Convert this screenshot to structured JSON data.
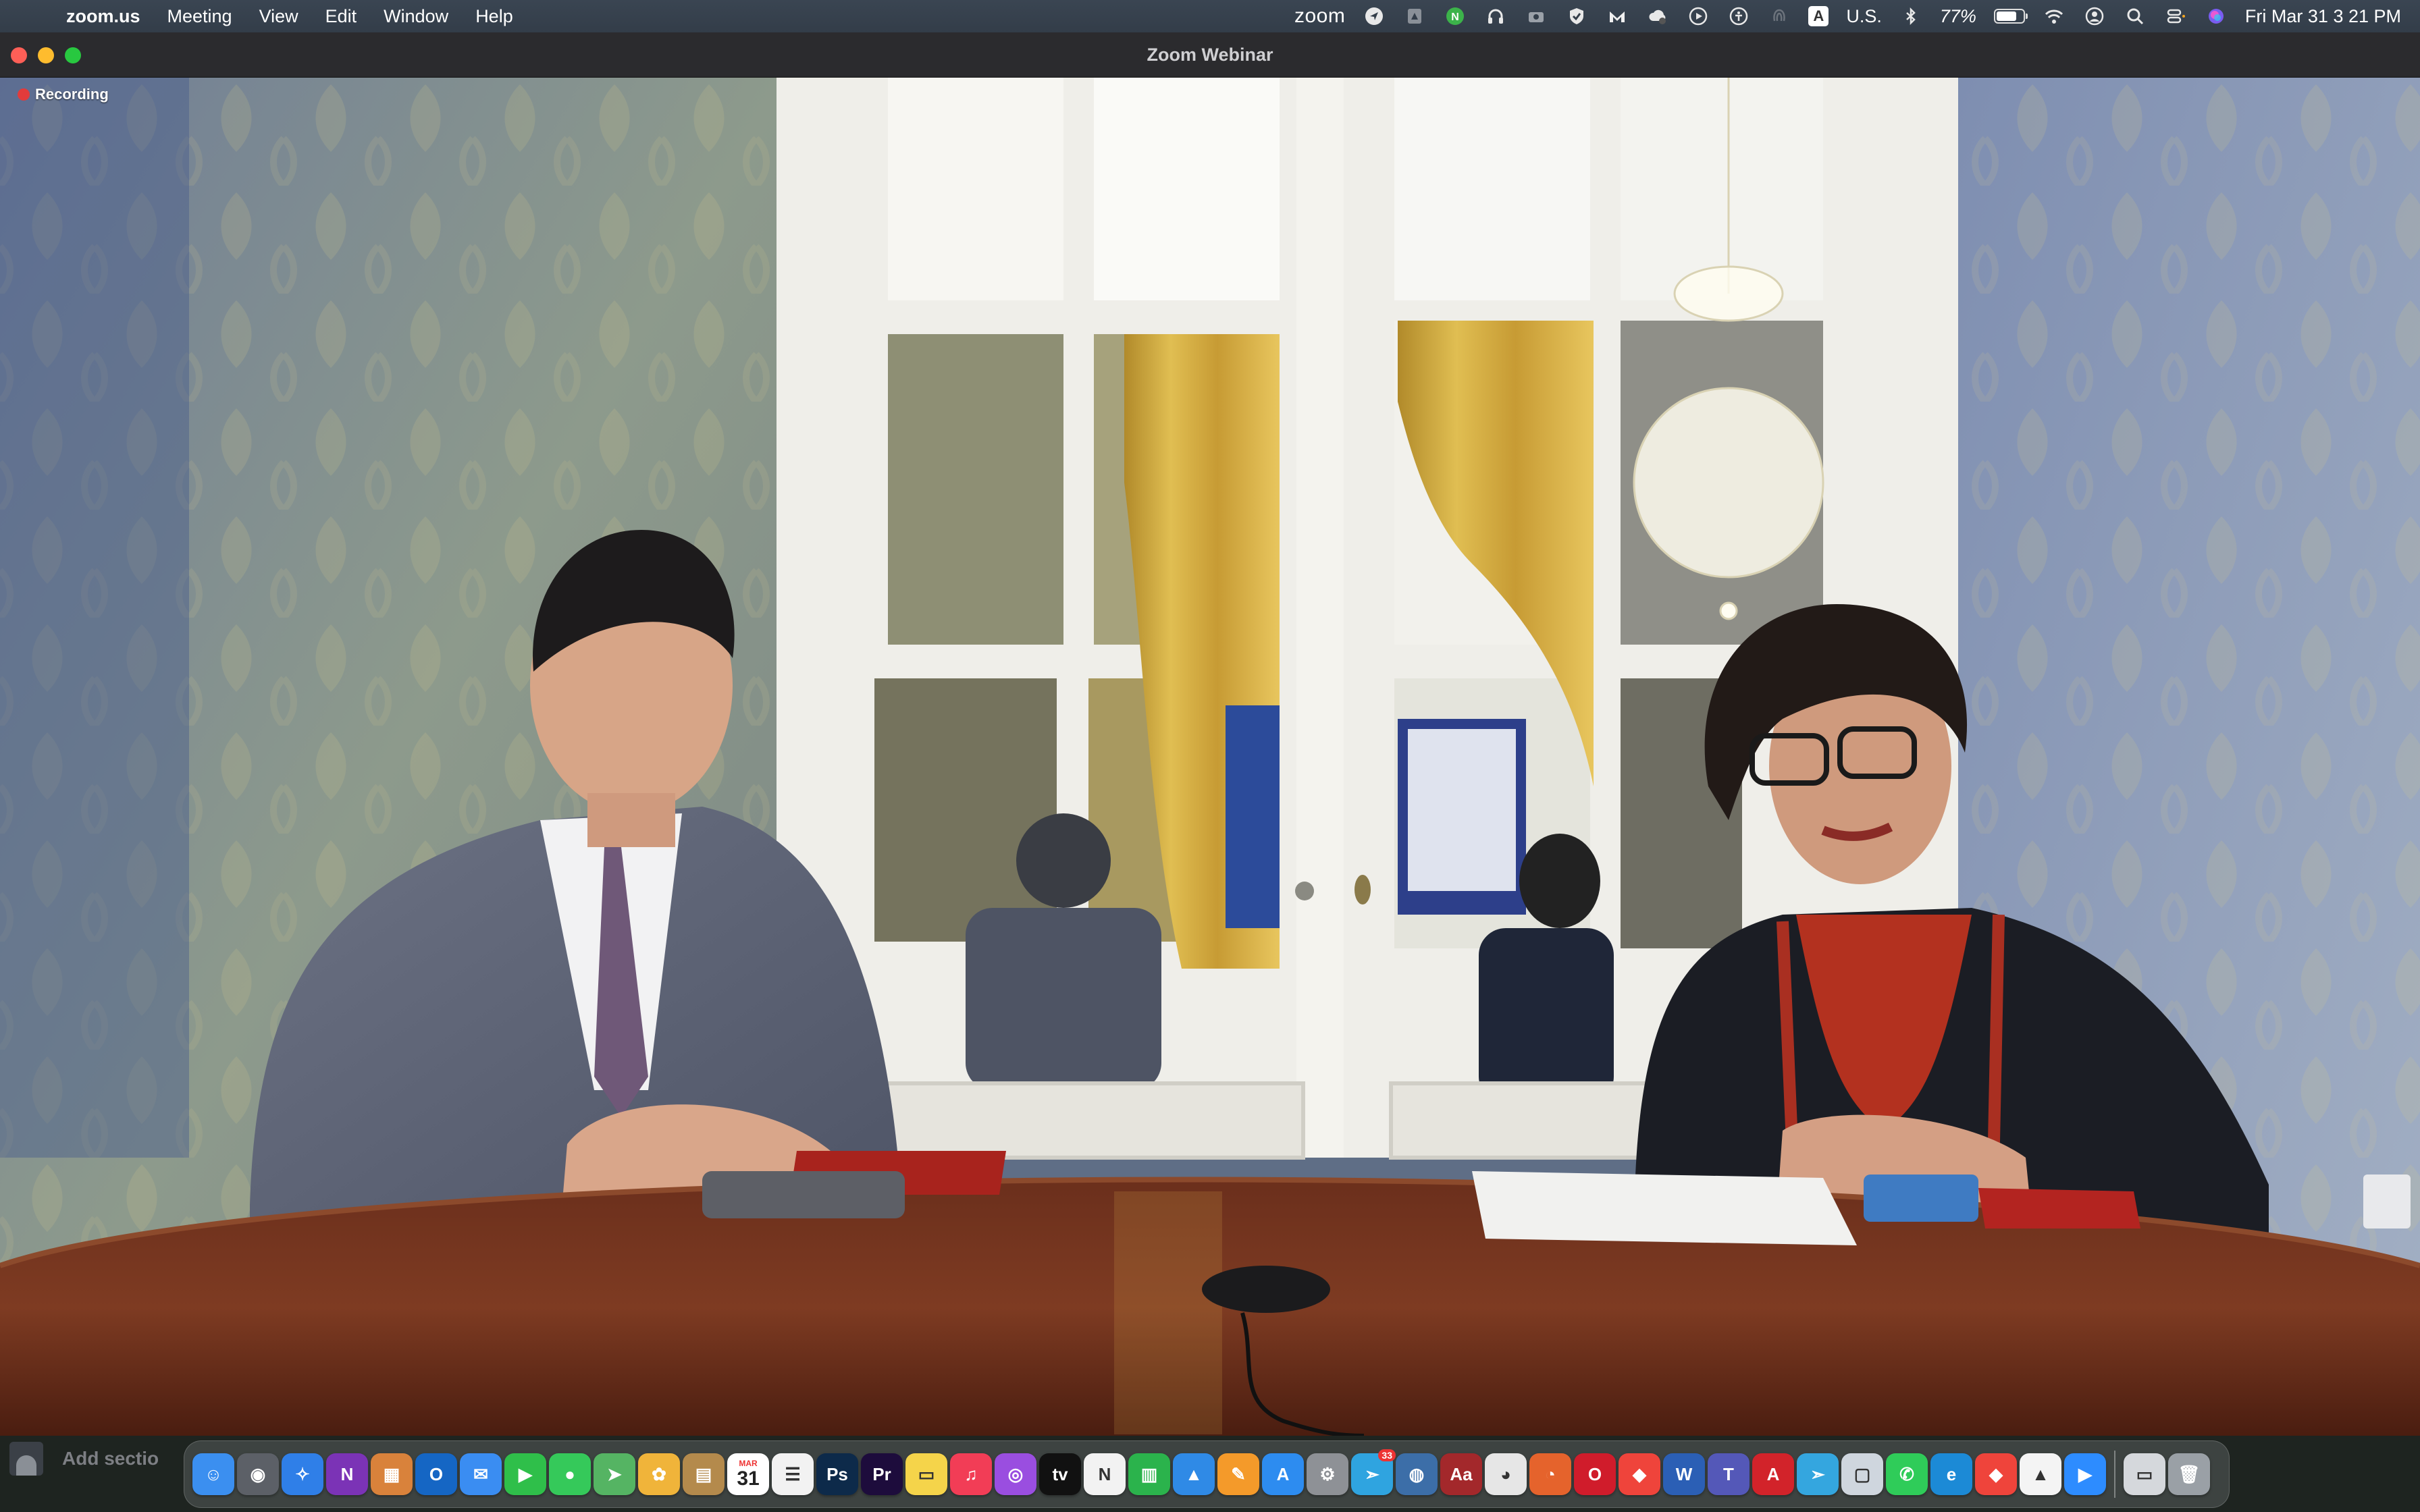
{
  "menubar": {
    "app_name": "zoom.us",
    "menus": [
      "Meeting",
      "View",
      "Edit",
      "Window",
      "Help"
    ],
    "zoom_brand": "zoom",
    "input_source": "U.S.",
    "input_badge": "A",
    "battery_percent": "77%",
    "battery_level": 0.77,
    "datetime": "Fri Mar 31  3 21 PM"
  },
  "window": {
    "title": "Zoom Webinar"
  },
  "video": {
    "recording_label": "Recording"
  },
  "bottom": {
    "add_section_label": "Add sectio"
  },
  "dock": {
    "calendar_month": "MAR",
    "calendar_day": "31",
    "telegram_badge": "33",
    "apps": [
      {
        "name": "finder",
        "color": "#3b8ff0",
        "glyph": "☺"
      },
      {
        "name": "screenshot",
        "color": "#5c6067",
        "glyph": "◉"
      },
      {
        "name": "safari",
        "color": "#2f7fe8",
        "glyph": "✧"
      },
      {
        "name": "onenote",
        "color": "#7b33b6",
        "glyph": "N"
      },
      {
        "name": "launchpad",
        "color": "#d9823b",
        "glyph": "▦"
      },
      {
        "name": "outlook",
        "color": "#1566c4",
        "glyph": "O"
      },
      {
        "name": "mail",
        "color": "#3a8df2",
        "glyph": "✉"
      },
      {
        "name": "facetime",
        "color": "#2fbf4a",
        "glyph": "▶"
      },
      {
        "name": "messages",
        "color": "#35c95a",
        "glyph": "●"
      },
      {
        "name": "maps",
        "color": "#55b463",
        "glyph": "➤"
      },
      {
        "name": "photos",
        "color": "#f0b43a",
        "glyph": "✿"
      },
      {
        "name": "notes-app",
        "color": "#b48a4c",
        "glyph": "▤"
      },
      {
        "name": "calendar",
        "color": "#ffffff",
        "glyph": ""
      },
      {
        "name": "reminders",
        "color": "#f2f2f2",
        "glyph": "☰"
      },
      {
        "name": "photoshop",
        "color": "#0d2a4a",
        "glyph": "Ps"
      },
      {
        "name": "premiere",
        "color": "#1d0c3c",
        "glyph": "Pr"
      },
      {
        "name": "notes",
        "color": "#f5d44a",
        "glyph": "▭"
      },
      {
        "name": "music",
        "color": "#f23d56",
        "glyph": "♫"
      },
      {
        "name": "podcasts",
        "color": "#9a4ee0",
        "glyph": "◎"
      },
      {
        "name": "apple-tv",
        "color": "#111111",
        "glyph": "tv"
      },
      {
        "name": "news",
        "color": "#f2f2f2",
        "glyph": "N"
      },
      {
        "name": "numbers",
        "color": "#2bb34c",
        "glyph": "▥"
      },
      {
        "name": "keynote",
        "color": "#2f8ae6",
        "glyph": "▲"
      },
      {
        "name": "pages",
        "color": "#f49a2a",
        "glyph": "✎"
      },
      {
        "name": "app-store",
        "color": "#2d8cf0",
        "glyph": "A"
      },
      {
        "name": "system-settings",
        "color": "#8e9196",
        "glyph": "⚙"
      },
      {
        "name": "telegram",
        "color": "#2fa4e0",
        "glyph": "➣"
      },
      {
        "name": "proxyman",
        "color": "#3c6ea8",
        "glyph": "◍"
      },
      {
        "name": "dictionary",
        "color": "#a3282b",
        "glyph": "Aa"
      },
      {
        "name": "chrome",
        "color": "#e6e6e6",
        "glyph": "◕"
      },
      {
        "name": "firefox",
        "color": "#e5632c",
        "glyph": "◔"
      },
      {
        "name": "opera",
        "color": "#d01c2b",
        "glyph": "O"
      },
      {
        "name": "anydesk",
        "color": "#ef443b",
        "glyph": "◆"
      },
      {
        "name": "word",
        "color": "#2b5fb5",
        "glyph": "W"
      },
      {
        "name": "teams",
        "color": "#5458b8",
        "glyph": "T"
      },
      {
        "name": "acrobat",
        "color": "#d2232a",
        "glyph": "A"
      },
      {
        "name": "telegram-alt",
        "color": "#34a6df",
        "glyph": "➣"
      },
      {
        "name": "preview",
        "color": "#cfd6de",
        "glyph": "▢"
      },
      {
        "name": "whatsapp",
        "color": "#2fcc59",
        "glyph": "✆"
      },
      {
        "name": "edge",
        "color": "#1c8ad6",
        "glyph": "e"
      },
      {
        "name": "anydesk-alt",
        "color": "#ef443b",
        "glyph": "◆"
      },
      {
        "name": "google-drive",
        "color": "#f4f4f4",
        "glyph": "▲"
      },
      {
        "name": "zoom",
        "color": "#2d8cff",
        "glyph": "▶"
      },
      {
        "name": "downloads-stack",
        "color": "#d5d8dc",
        "glyph": "▭"
      },
      {
        "name": "trash",
        "color": "#9aa0a6",
        "glyph": "🗑"
      }
    ]
  }
}
